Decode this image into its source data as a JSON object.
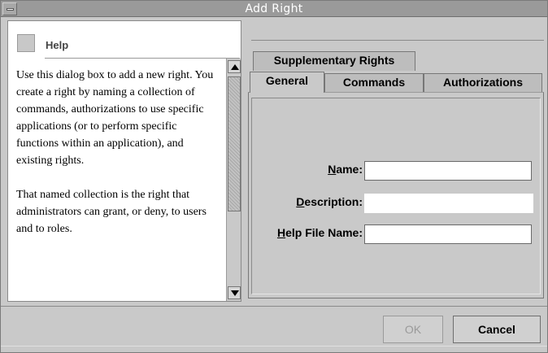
{
  "window": {
    "title": "Add Right"
  },
  "help": {
    "title": "Help",
    "paragraphs": [
      "Use this dialog box to add a new right. You create a right by naming a collection of commands, authorizations to use specific applications (or to perform specific functions within an application), and existing rights.",
      "That named collection is the right that administrators can grant, or deny, to users and to roles."
    ]
  },
  "tabs": {
    "supplementary": "Supplementary Rights",
    "general": "General",
    "commands": "Commands",
    "authorizations": "Authorizations",
    "active": "general"
  },
  "form": {
    "name": {
      "label_key": "N",
      "label_rest": "ame:",
      "value": ""
    },
    "description": {
      "label_key": "D",
      "label_rest": "escription:",
      "value": ""
    },
    "help_file": {
      "label_key": "H",
      "label_rest": "elp File Name:",
      "value": ""
    }
  },
  "buttons": {
    "ok": "OK",
    "cancel": "Cancel"
  }
}
